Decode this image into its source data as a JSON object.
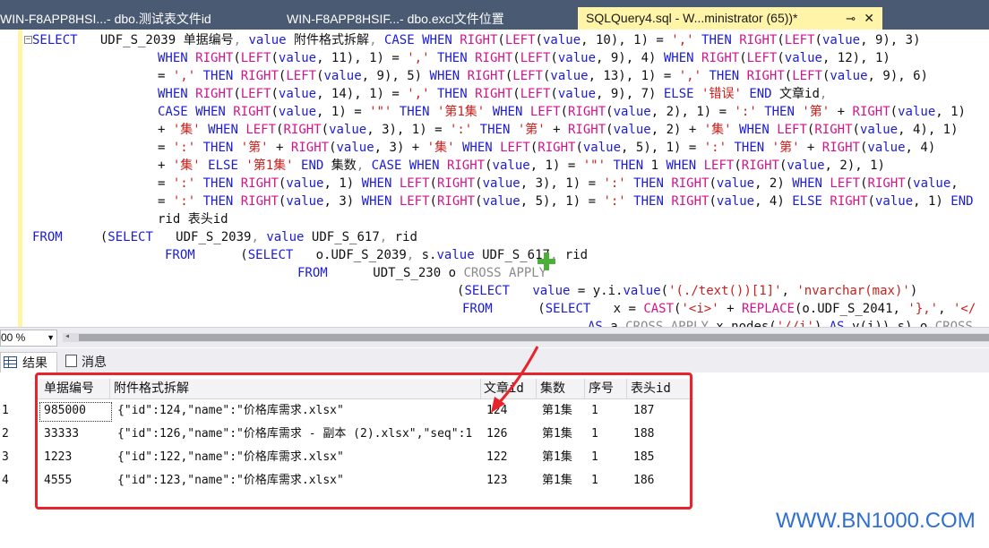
{
  "tabs": [
    {
      "label": "WIN-F8APP8HSI...- dbo.测试表文件id"
    },
    {
      "label": "WIN-F8APP8HSIF...- dbo.excl文件位置"
    },
    {
      "label": "SQLQuery4.sql - W...ministrator (65))*",
      "pin": "⊸",
      "close": "✕"
    }
  ],
  "editor": {
    "zoom": "00 %"
  },
  "results": {
    "tab_results": "结果",
    "tab_messages": "消息",
    "columns": [
      "单据编号",
      "附件格式拆解",
      "文章id",
      "集数",
      "序号",
      "表头id"
    ],
    "rows": [
      {
        "n": "1",
        "c": [
          "985000",
          "{\"id\":124,\"name\":\"价格库需求.xlsx\"",
          "124",
          "第1集",
          "1",
          "187"
        ]
      },
      {
        "n": "2",
        "c": [
          "33333",
          "{\"id\":126,\"name\":\"价格库需求 - 副本 (2).xlsx\",\"seq\":1",
          "126",
          "第1集",
          "1",
          "188"
        ]
      },
      {
        "n": "3",
        "c": [
          "1223",
          "{\"id\":122,\"name\":\"价格库需求.xlsx\"",
          "122",
          "第1集",
          "1",
          "185"
        ]
      },
      {
        "n": "4",
        "c": [
          "4555",
          "{\"id\":123,\"name\":\"价格库需求.xlsx\"",
          "123",
          "第1集",
          "1",
          "186"
        ]
      }
    ]
  },
  "watermark": "WWW.BN1000.COM",
  "colors": {
    "tabbar": "#4a5a73",
    "active_tab": "#fff4a7",
    "keyword": "#1b1bd8",
    "string": "#c8201c",
    "annotation": "#e8232b",
    "watermark": "#2f6fd1"
  }
}
